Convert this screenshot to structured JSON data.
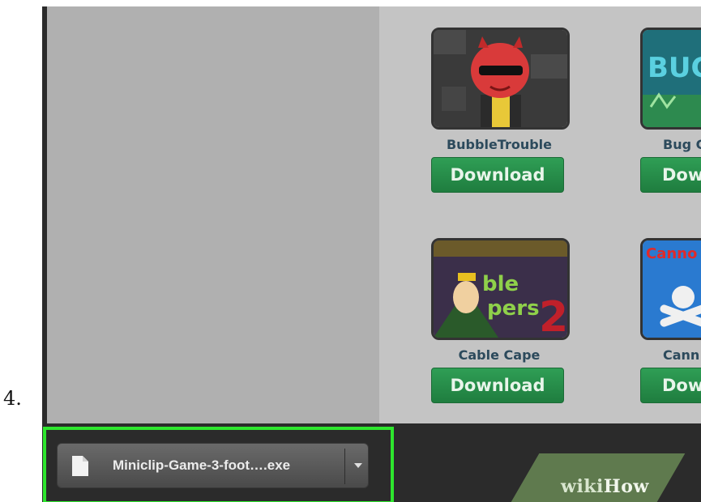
{
  "step": {
    "number": "4."
  },
  "games": [
    {
      "title": "BubbleTrouble",
      "button": "Download",
      "icon": "devil-character-thumbnail"
    },
    {
      "title": "Bug G",
      "button": "Dow",
      "icon": "bug-game-thumbnail"
    },
    {
      "title": "Cable Cape",
      "button": "Download",
      "icon": "cable-capers-thumbnail"
    },
    {
      "title": "Cann",
      "button": "Dow",
      "icon": "cannon-game-thumbnail"
    }
  ],
  "download_bar": {
    "file_name": "Miniclip-Game-3-foot….exe",
    "file_icon": "file-icon",
    "menu_icon": "chevron-down-icon",
    "highlight_color": "#2ee62e"
  },
  "watermark": {
    "wiki": "wiki",
    "how": "How"
  }
}
